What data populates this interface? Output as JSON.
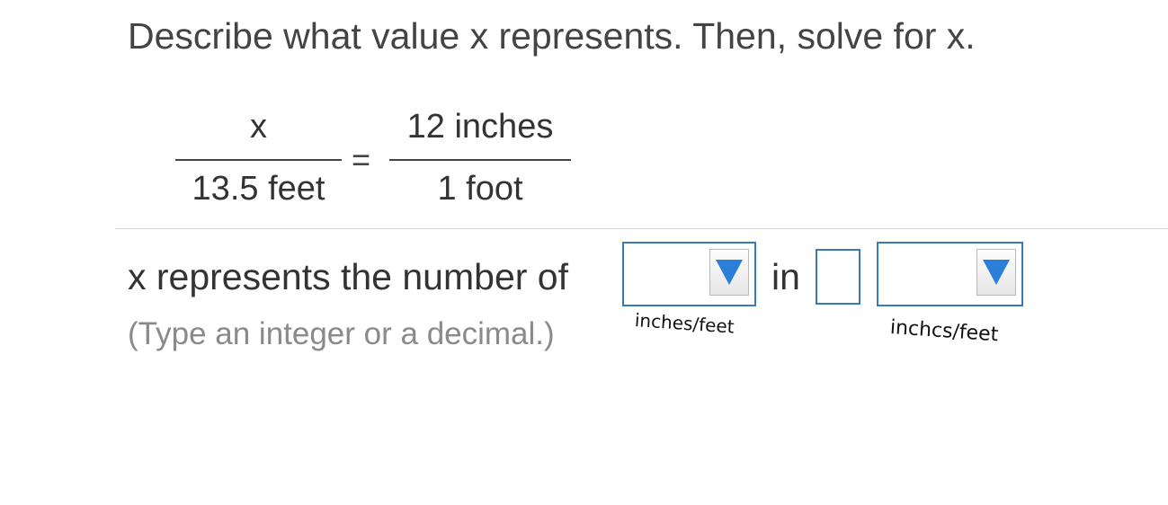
{
  "question": {
    "instruction": "Describe what value x represents. Then, solve for x."
  },
  "equation": {
    "left_numerator": "x",
    "left_denominator": "13.5 feet",
    "equals": "=",
    "right_numerator": "12 inches",
    "right_denominator": "1 foot"
  },
  "answer": {
    "sentence_prefix": "x represents the number of",
    "unit_dropdown_1": {
      "selected": ""
    },
    "in_word": "in",
    "value_input": {
      "value": ""
    },
    "unit_dropdown_2": {
      "selected": ""
    },
    "hint": "(Type an integer or a decimal.)"
  },
  "annotations": {
    "note_1": "inches/feet",
    "note_2": "inchcs/feet"
  },
  "colors": {
    "accent": "#3a78b8",
    "arrow": "#2b7fd6",
    "hint": "#8a8a8a"
  },
  "icons": {
    "dropdown_arrow": "triangle-down-icon"
  }
}
